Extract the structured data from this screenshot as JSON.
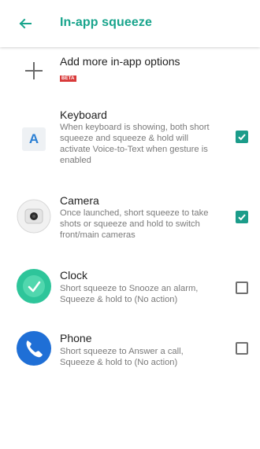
{
  "header": {
    "title": "In-app squeeze",
    "accent_color": "#18a48c",
    "back_icon": "arrow-left-icon"
  },
  "add_more": {
    "label": "Add more in-app options",
    "badge": "BETA",
    "icon": "plus-icon"
  },
  "apps": [
    {
      "name": "Keyboard",
      "description": "When keyboard is showing, both short squeeze and squeeze & hold will activate Voice-to-Text when gesture is enabled",
      "icon": "keyboard-icon",
      "icon_glyph": "A",
      "checked": true
    },
    {
      "name": "Camera",
      "description": "Once launched, short squeeze to take shots or squeeze and hold to switch front/main cameras",
      "icon": "camera-icon",
      "checked": true
    },
    {
      "name": "Clock",
      "description": "Short squeeze to Snooze an alarm, Squeeze & hold to (No action)",
      "icon": "clock-icon",
      "checked": false
    },
    {
      "name": "Phone",
      "description": "Short squeeze to Answer a call, Squeeze & hold to (No action)",
      "icon": "phone-icon",
      "checked": false
    }
  ],
  "colors": {
    "checkbox_on": "#1b9c8a",
    "badge": "#d83a3a",
    "clock": "#2ec59a",
    "phone": "#1f6fd6"
  }
}
